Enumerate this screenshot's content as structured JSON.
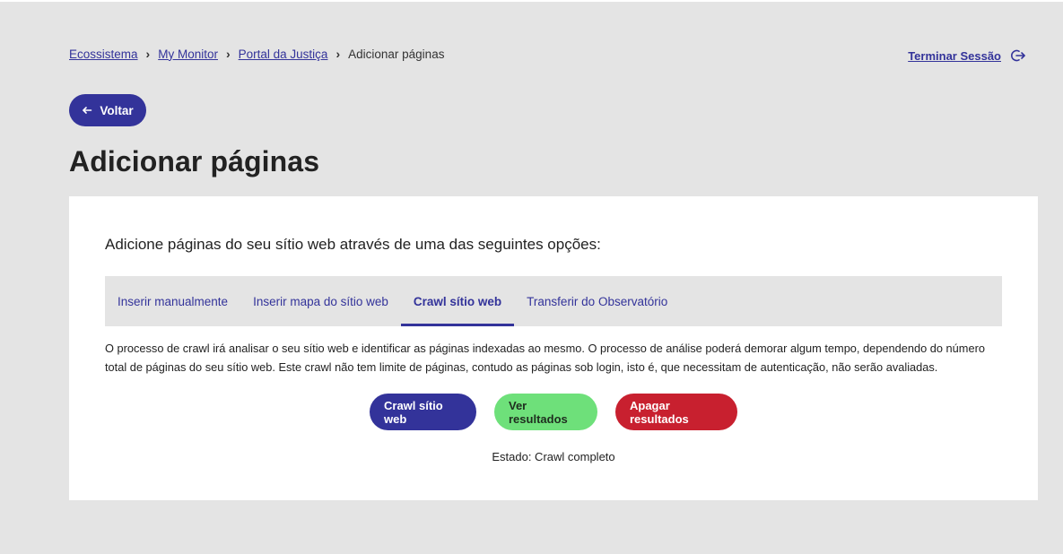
{
  "breadcrumb": {
    "items": [
      "Ecossistema",
      "My Monitor",
      "Portal da Justiça"
    ],
    "current": "Adicionar páginas",
    "separator": "›"
  },
  "header": {
    "logout_label": "Terminar Sessão",
    "logout_icon": "logout-icon"
  },
  "back_button": {
    "label": "Voltar",
    "icon": "arrow-left-icon"
  },
  "page_title": "Adicionar páginas",
  "card": {
    "intro": "Adicione páginas do seu sítio web através de uma das seguintes opções:",
    "tabs": [
      {
        "label": "Inserir manualmente",
        "active": false
      },
      {
        "label": "Inserir mapa do sítio web",
        "active": false
      },
      {
        "label": "Crawl sítio web",
        "active": true
      },
      {
        "label": "Transferir do Observatório",
        "active": false
      }
    ],
    "description": "O processo de crawl irá analisar o seu sítio web e identificar as páginas indexadas ao mesmo. O processo de análise poderá demorar algum tempo, dependendo do número total de páginas do seu sítio web. Este crawl não tem limite de páginas, contudo as páginas sob login, isto é, que necessitam de autenticação, não serão avaliadas.",
    "buttons": {
      "crawl": "Crawl sítio web",
      "results": "Ver resultados",
      "delete": "Apagar resultados"
    },
    "status": "Estado: Crawl completo"
  },
  "colors": {
    "primary": "#33339a",
    "success": "#6ee07a",
    "danger": "#c8202f",
    "background": "#e4e4e4"
  }
}
